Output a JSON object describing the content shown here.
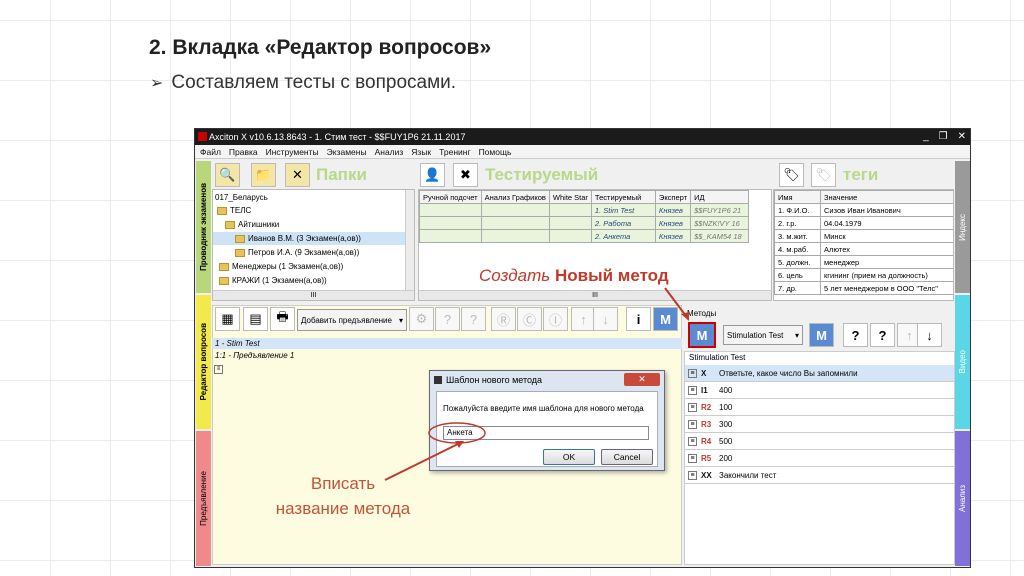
{
  "slide": {
    "title": "2. Вкладка «Редактор вопросов»",
    "bullet_icon": "arrow-bullet-icon",
    "subtitle": "Составляем тесты с вопросами."
  },
  "window": {
    "title": "Axciton X v10.6.13.8643 - 1. Стим тест - $$FUY1P6 21.11.2017",
    "controls": [
      "_",
      "❐",
      "✕"
    ]
  },
  "menu": [
    "Файл",
    "Правка",
    "Инструменты",
    "Экзамены",
    "Анализ",
    "Язык",
    "Тренинг",
    "Помощь"
  ],
  "side_tabs": {
    "explorer": "Проводник экзаменов",
    "editor": "Редактор вопросов",
    "presentation": "Предъявление",
    "index": "Индекс",
    "video": "Видео",
    "analysis": "Анализ"
  },
  "folders_panel": {
    "header": "Папки",
    "tree": [
      {
        "label": "017_Беларусь",
        "level": 0,
        "folder": false
      },
      {
        "label": "ТЕЛС",
        "level": 0,
        "folder": true
      },
      {
        "label": "Айтишники",
        "level": 1,
        "folder": true
      },
      {
        "label": "Иванов В.М. (3 Экзамен(а,ов))",
        "level": 2,
        "folder": true,
        "selected": true
      },
      {
        "label": "Петров И.А. (9 Экзамен(а,ов))",
        "level": 2,
        "folder": true
      },
      {
        "label": "Менеджеры (1 Экзамен(а,ов))",
        "level": 1,
        "folder": true
      },
      {
        "label": "КРАЖИ (1 Экзамен(а,ов))",
        "level": 1,
        "folder": true
      }
    ],
    "scroll_label": "III"
  },
  "tested_panel": {
    "header": "Тестируемый",
    "columns": [
      "Ручной подсчет",
      "Анализ Графиков",
      "White Star",
      "Тестируемый",
      "Эксперт",
      "ИД"
    ],
    "rows": [
      {
        "name": "1. Stim Test",
        "expert": "Князев",
        "id": "$$FUY1P6",
        "extra": "21"
      },
      {
        "name": "2. Работа",
        "expert": "Князев",
        "id": "$$NZK!VY",
        "extra": "16"
      },
      {
        "name": "2. Анкета",
        "expert": "Князев",
        "id": "$$_KAM54",
        "extra": "18"
      }
    ],
    "scroll_label": "III"
  },
  "tags_panel": {
    "header": "теги",
    "columns": [
      "Имя",
      "Значение"
    ],
    "rows": [
      [
        "1. Ф.И.О.",
        "Сизов Иван Иванович"
      ],
      [
        "2. г.р.",
        "04.04.1979"
      ],
      [
        "3. м.жит.",
        "Минск"
      ],
      [
        "4. м.раб.",
        "Алютех"
      ],
      [
        "5. должн.",
        "менеджер"
      ],
      [
        "6. цель",
        "кгининг (прием на должность)"
      ],
      [
        "7. др.",
        "5 лет менеджером в ООО \"Телс\""
      ]
    ]
  },
  "editor": {
    "add_presentation": "Добавить предъявление",
    "tree": [
      "1 - Stim Test",
      "1:1 - Предъявление 1"
    ]
  },
  "methods": {
    "label": "Методы",
    "dropdown": "Stimulation Test",
    "list_title": "Stimulation Test",
    "rows": [
      {
        "code": "X",
        "text": "Ответьте, какое число Вы запомнили",
        "color": "#111111",
        "selected": true
      },
      {
        "code": "I1",
        "text": "400",
        "color": "#111111"
      },
      {
        "code": "R2",
        "text": "100",
        "color": "#c0392b"
      },
      {
        "code": "R3",
        "text": "300",
        "color": "#c0392b"
      },
      {
        "code": "R4",
        "text": "500",
        "color": "#c0392b"
      },
      {
        "code": "R5",
        "text": "200",
        "color": "#c0392b"
      },
      {
        "code": "XX",
        "text": "Закончили тест",
        "color": "#111111"
      }
    ]
  },
  "dialog": {
    "title": "Шаблон нового метода",
    "prompt": "Пожалуйста введите имя шаблона для нового метода",
    "value": "Анкета",
    "ok": "OK",
    "cancel": "Cancel"
  },
  "annotations": {
    "create_italic": "Создать",
    "create_bold": "Новый метод",
    "enter_line1": "Вписать",
    "enter_line2": "название метода"
  }
}
